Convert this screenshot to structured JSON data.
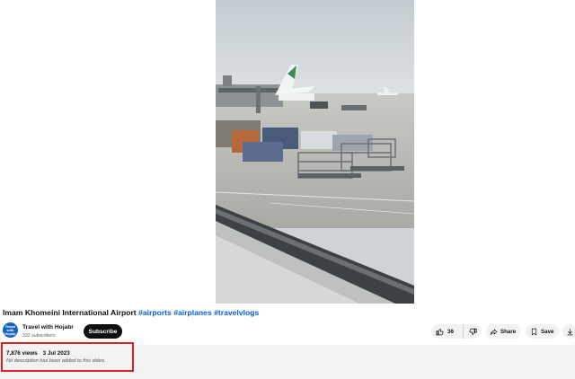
{
  "video": {
    "title": "Imam Khomeini International Airport",
    "hashtags": [
      "#airports",
      "#airplanes",
      "#travelvlogs"
    ],
    "thumbnail_icon": "airport-apron-scene"
  },
  "channel": {
    "name": "Travel with Hojabr",
    "subscribers": "332 subscribers",
    "avatar_text": "Travel with Hojabr",
    "subscribe_label": "Subscribe"
  },
  "actions": {
    "like_count": "36",
    "share_label": "Share",
    "save_label": "Save"
  },
  "description": {
    "views": "7,876 views",
    "date": "3 Jul 2023",
    "text": "No description has been added to this video."
  },
  "colors": {
    "hashtag": "#065fd4",
    "subscribe_bg": "#0f0f0f",
    "highlight": "#e0201e",
    "pill_bg": "#f2f2f2"
  }
}
